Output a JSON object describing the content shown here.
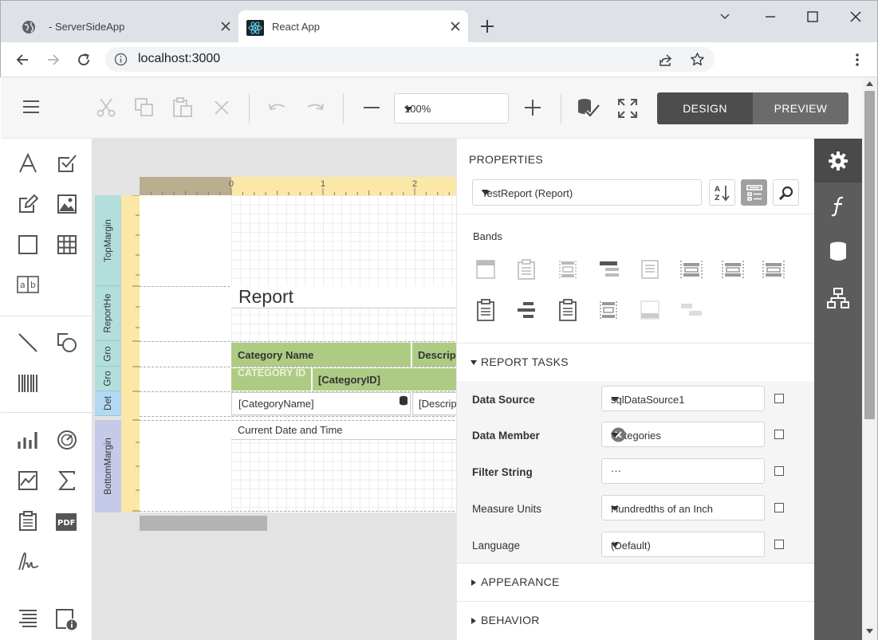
{
  "browser": {
    "tabs": [
      {
        "title": "- ServerSideApp",
        "active": false
      },
      {
        "title": "React App",
        "active": true
      }
    ],
    "url": "localhost:3000"
  },
  "toolbar": {
    "zoom_value": "100%",
    "design_label": "DESIGN",
    "preview_label": "PREVIEW"
  },
  "surface": {
    "ruler_numbers": [
      "0",
      "1",
      "2"
    ],
    "bands": {
      "top_margin": "TopMargin",
      "report_header": "ReportHe",
      "group_header": "Gro",
      "group_header2": "Gro",
      "detail": "Det",
      "bottom_margin": "BottomMargin"
    },
    "report_title": "Report",
    "category_name_header": "Category Name",
    "description_header": "Descrip",
    "category_id_label": "CATEGORY ID",
    "category_id_field": "[CategoryID]",
    "category_name_field": "[CategoryName]",
    "description_field": "[Descrip",
    "current_date": "Current Date and Time"
  },
  "properties": {
    "heading": "PROPERTIES",
    "object_selector": "TestReport (Report)",
    "bands_title": "Bands",
    "report_tasks_title": "REPORT TASKS",
    "rows": [
      {
        "label": "Data Source",
        "value": "sqlDataSource1"
      },
      {
        "label": "Data Member",
        "value": "Categories"
      },
      {
        "label": "Filter String",
        "value": ""
      },
      {
        "label": "Measure Units",
        "value": "Hundredths of an Inch"
      },
      {
        "label": "Language",
        "value": "(Default)"
      }
    ],
    "filter_ellipsis": "···",
    "appearance_title": "APPEARANCE",
    "behavior_title": "BEHAVIOR"
  },
  "colors": {
    "accent_green": "#aecb84",
    "ruler_yellow": "#fbe7a6",
    "band_cyan": "#b2dfdb",
    "band_lavender": "#c5cae9",
    "band_blue": "#b3d9f2",
    "sidebar_dark": "#5c5c5c"
  }
}
